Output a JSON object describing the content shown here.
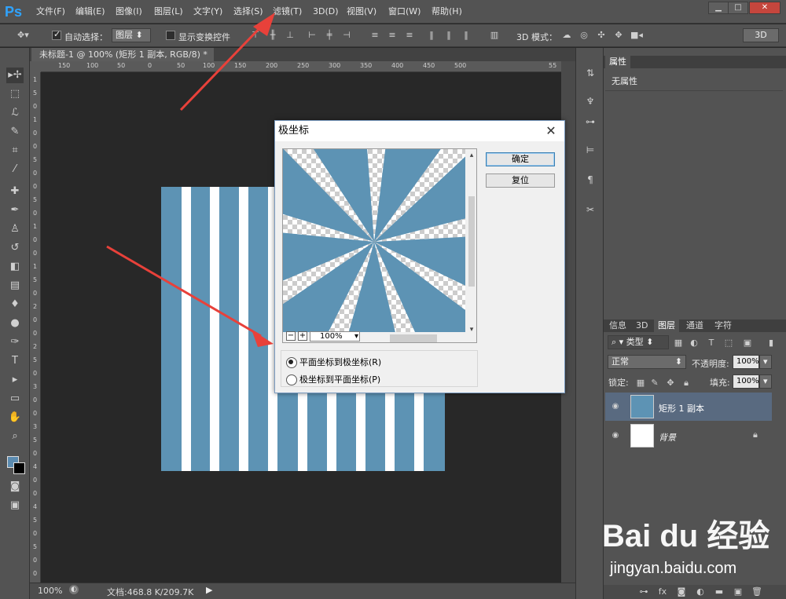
{
  "app": {
    "logo": "Ps"
  },
  "menu": [
    "文件(F)",
    "编辑(E)",
    "图像(I)",
    "图层(L)",
    "文字(Y)",
    "选择(S)",
    "滤镜(T)",
    "3D(D)",
    "视图(V)",
    "窗口(W)",
    "帮助(H)"
  ],
  "options": {
    "auto_select_label": "自动选择：",
    "auto_select_value": "图层",
    "show_transform_label": "显示变换控件",
    "mode_3d_label": "3D 模式：",
    "btn_3d": "3D"
  },
  "document": {
    "tab_title": "未标题-1 @ 100% (矩形 1 副本, RGB/8) *",
    "close_glyph": "×",
    "zoom": "100%",
    "doc_size": "文档:468.8 K/209.7K",
    "ruler_h": [
      "150",
      "100",
      "50",
      "0",
      "50",
      "100",
      "150",
      "200",
      "250",
      "300",
      "350",
      "400",
      "450",
      "500",
      "55"
    ],
    "ruler_v": [
      "1",
      "5",
      "0",
      "1",
      "0",
      "0",
      "5",
      "0",
      "0",
      "5",
      "0",
      "1",
      "0",
      "0",
      "1",
      "5",
      "0",
      "2",
      "0",
      "0",
      "2",
      "5",
      "0",
      "3",
      "0",
      "0",
      "3",
      "5",
      "0",
      "4",
      "0",
      "0",
      "4",
      "5",
      "0",
      "5",
      "0",
      "0"
    ]
  },
  "dialog": {
    "title": "极坐标",
    "ok": "确定",
    "reset": "复位",
    "zoom_minus": "−",
    "zoom_plus": "+",
    "zoom_value": "100%",
    "option1": "平面坐标到极坐标(R)",
    "option2": "极坐标到平面坐标(P)",
    "selected_option": "option1"
  },
  "properties": {
    "tab": "属性",
    "body": "无属性"
  },
  "layers_panel": {
    "tabs": [
      "信息",
      "3D",
      "图层",
      "通道",
      "字符"
    ],
    "active_tab": "图层",
    "kind_filter": "类型",
    "blend_mode": "正常",
    "opacity_label": "不透明度:",
    "opacity_value": "100%",
    "lock_label": "锁定:",
    "fill_label": "填充:",
    "fill_value": "100%",
    "layers": [
      {
        "name": "矩形 1 副本",
        "selected": true
      },
      {
        "name": "背景",
        "selected": false
      }
    ]
  },
  "watermark": {
    "logo": "Bai du 经验",
    "url": "jingyan.baidu.com"
  },
  "colors": {
    "stripe_blue": "#5d93b4",
    "accent_red": "#e8413a",
    "foreground": "#5b8bb0"
  },
  "icons": [
    "move-tool-icon",
    "marquee-tool-icon",
    "lasso-tool-icon",
    "quick-select-icon",
    "crop-tool-icon",
    "eyedropper-icon",
    "healing-brush-icon",
    "brush-tool-icon",
    "clone-stamp-icon",
    "history-brush-icon",
    "eraser-icon",
    "gradient-icon",
    "blur-icon",
    "dodge-icon",
    "pen-tool-icon",
    "type-tool-icon",
    "path-select-icon",
    "shape-tool-icon",
    "hand-tool-icon",
    "zoom-tool-icon"
  ]
}
